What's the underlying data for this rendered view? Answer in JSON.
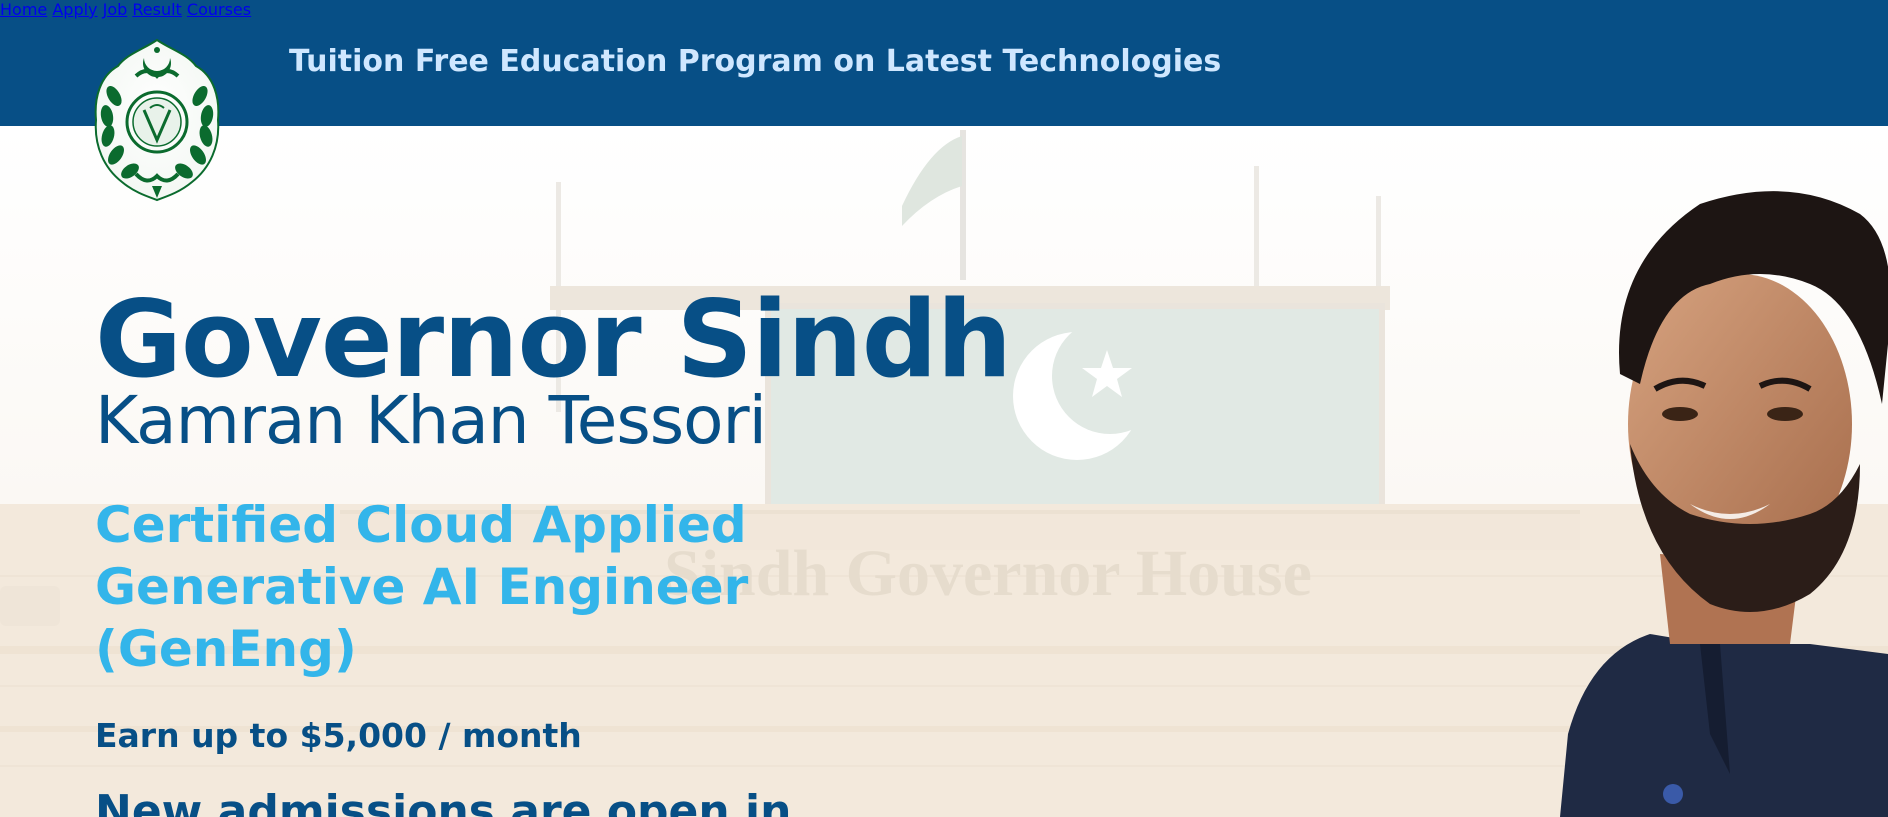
{
  "header": {
    "brand_title": "Tuition Free Education Program on Latest Technologies",
    "nav": [
      {
        "label": "Home"
      },
      {
        "label": "Apply"
      },
      {
        "label": "Job"
      },
      {
        "label": "Result"
      },
      {
        "label": "Courses"
      }
    ]
  },
  "hero": {
    "title": "Governor Sindh",
    "subtitle": "Kamran Khan Tessori",
    "program_lines": [
      "Certified Cloud Applied",
      "Generative AI Engineer",
      "(GenEng)"
    ],
    "earn_text": "Earn up to $5,000 / month",
    "admission_text": "New admissions are open in",
    "building_sign": "Sindh Governor House"
  },
  "colors": {
    "header_bg": "#074f86",
    "brand_title": "#cfe7ff",
    "primary_text": "#074f86",
    "accent_text": "#33b5ea",
    "flag_green": "#0b5d3a",
    "logo_green": "#0b6b2e"
  },
  "icons": {
    "logo": "sindh-government-emblem-icon"
  }
}
